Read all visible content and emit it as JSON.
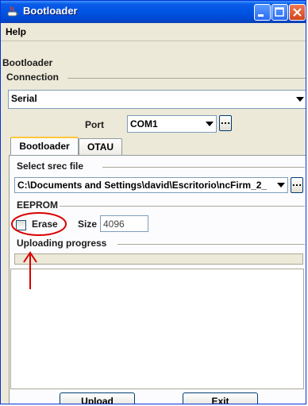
{
  "window": {
    "title": "Bootloader"
  },
  "menubar": {
    "help": "Help"
  },
  "main": {
    "heading": "Bootloader"
  },
  "connection": {
    "group_label": "Connection",
    "type_value": "Serial",
    "port_label": "Port",
    "port_value": "COM1",
    "browse_label": "..."
  },
  "tabs": [
    {
      "label": "Bootloader",
      "active": true
    },
    {
      "label": "OTAU",
      "active": false
    }
  ],
  "srec": {
    "group_label": "Select srec file",
    "path_value": "C:\\Documents and Settings\\david\\Escritorio\\ncFirm_2_",
    "browse_label": "..."
  },
  "eeprom": {
    "group_label": "EEPROM",
    "erase_label": "Erase",
    "erase_checked": false,
    "size_label": "Size",
    "size_value": "4096"
  },
  "progress": {
    "label": "Uploading progress",
    "value": 0
  },
  "buttons": {
    "upload": "Upload",
    "exit": "Exit"
  },
  "colors": {
    "titlebar": "#0054e3",
    "annotation": "#d90000",
    "tab_highlight": "#ffc83c"
  }
}
